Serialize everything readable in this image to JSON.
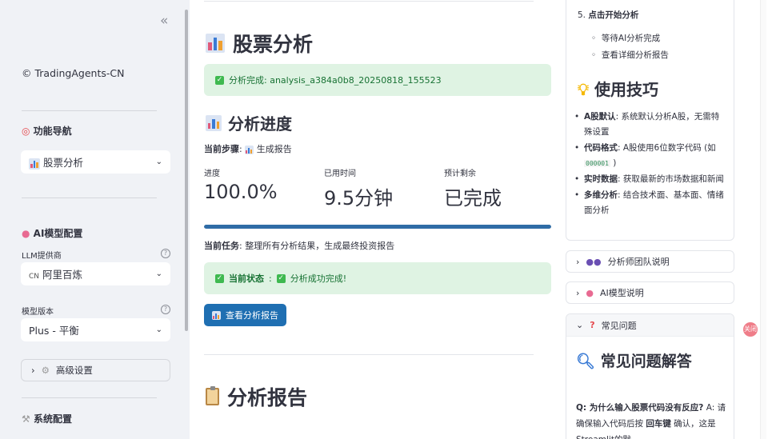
{
  "sidebar": {
    "collapse_glyph": "«",
    "brand": "TradingAgents-CN",
    "brand_icon": "copyright-icon",
    "nav_heading": "功能导航",
    "nav_select_value": "股票分析",
    "ai_heading": "AI模型配置",
    "llm_label": "LLM提供商",
    "llm_prefix": "CN",
    "llm_value": "阿里百炼",
    "model_label": "模型版本",
    "model_value": "Plus - 平衡",
    "advanced_label": "高级设置",
    "system_heading": "系统配置"
  },
  "main": {
    "page_title": "股票分析",
    "success_msg": "分析完成: analysis_a384a0b8_20250818_155523",
    "progress_heading": "分析进度",
    "step_label": "当前步骤",
    "step_value": "生成报告",
    "metrics": [
      {
        "label": "进度",
        "value": "100.0%"
      },
      {
        "label": "已用时间",
        "value": "9.5分钟"
      },
      {
        "label": "预计剩余",
        "value": "已完成"
      }
    ],
    "progress_fraction": 1.0,
    "task_label": "当前任务",
    "task_value": "整理所有分析结果，生成最终投资报告",
    "status_label": "当前状态",
    "status_value": "分析成功完成!",
    "view_report_button": "查看分析报告",
    "report_heading": "分析报告"
  },
  "right": {
    "step5_num": "5.",
    "step5_label": "点击开始分析",
    "step5_items": [
      "等待AI分析完成",
      "查看详细分析报告"
    ],
    "tips_heading": "使用技巧",
    "tips": [
      {
        "bold": "A股默认",
        "text": ": 系统默认分析A股，无需特殊设置"
      },
      {
        "bold": "代码格式",
        "text": ": A股使用6位数字代码 (如 ",
        "code": "000001",
        "tail": " )"
      },
      {
        "bold": "实时数据",
        "text": ": 获取最新的市场数据和新闻"
      },
      {
        "bold": "多维分析",
        "text": ": 结合技术面、基本面、情绪面分析"
      }
    ],
    "expander_team": "分析师团队说明",
    "expander_ai": "AI模型说明",
    "expander_faq": "常见问题",
    "faq_title": "常见问题解答",
    "faq_q": "Q: 为什么输入股票代码没有反应?",
    "faq_a_prefix": " A: 请确保输入代码后按 ",
    "faq_a_bold": "回车键",
    "faq_a_tail": " 确认，这是Streamlit的默"
  },
  "float_button_label": "关闭"
}
